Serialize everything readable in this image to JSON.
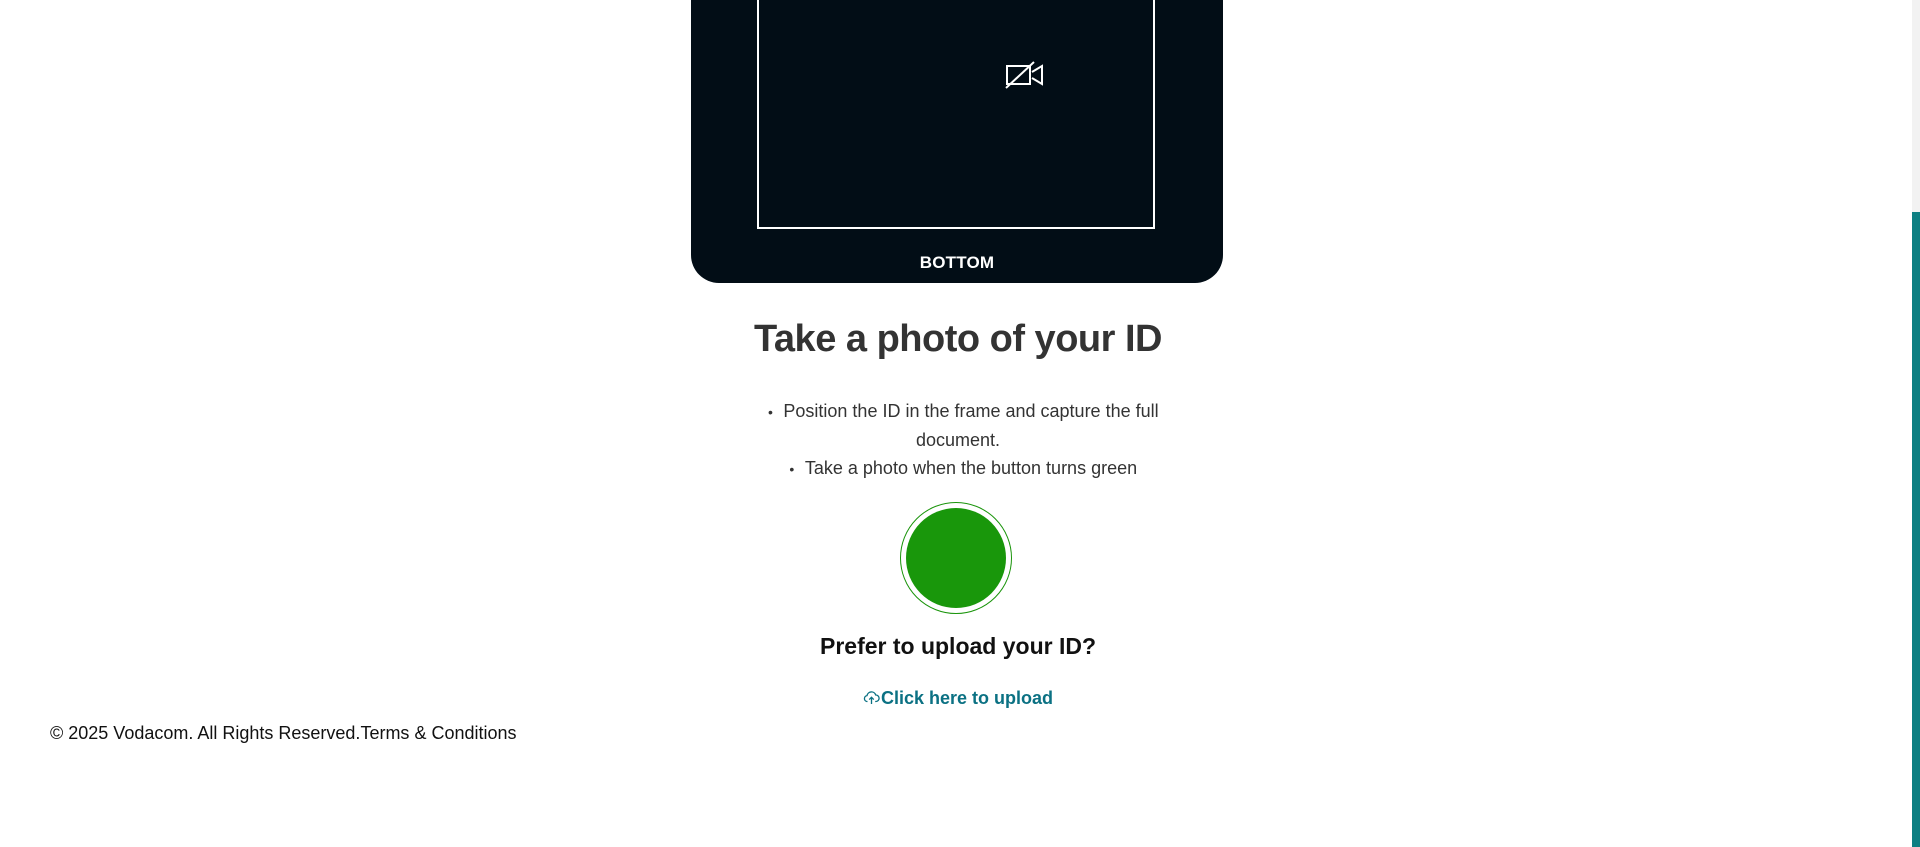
{
  "camera": {
    "bottom_label": "BOTTOM",
    "icon": "video-off-icon"
  },
  "title": "Take a photo of your ID",
  "instructions": [
    "Position the ID in the frame and capture the full document.",
    "Take a photo when the button turns green"
  ],
  "capture_button": {
    "color": "#19970b",
    "state": "ready"
  },
  "upload": {
    "prompt": "Prefer to upload your ID?",
    "link_label": "Click here to upload",
    "icon": "cloud-upload-icon",
    "link_color": "#0b7183"
  },
  "footer": {
    "copyright": "© 2025 Vodacom. All Rights Reserved.",
    "terms_link": "Terms & Conditions"
  },
  "scrollbar": {
    "thumb_color": "#0d7f82"
  }
}
